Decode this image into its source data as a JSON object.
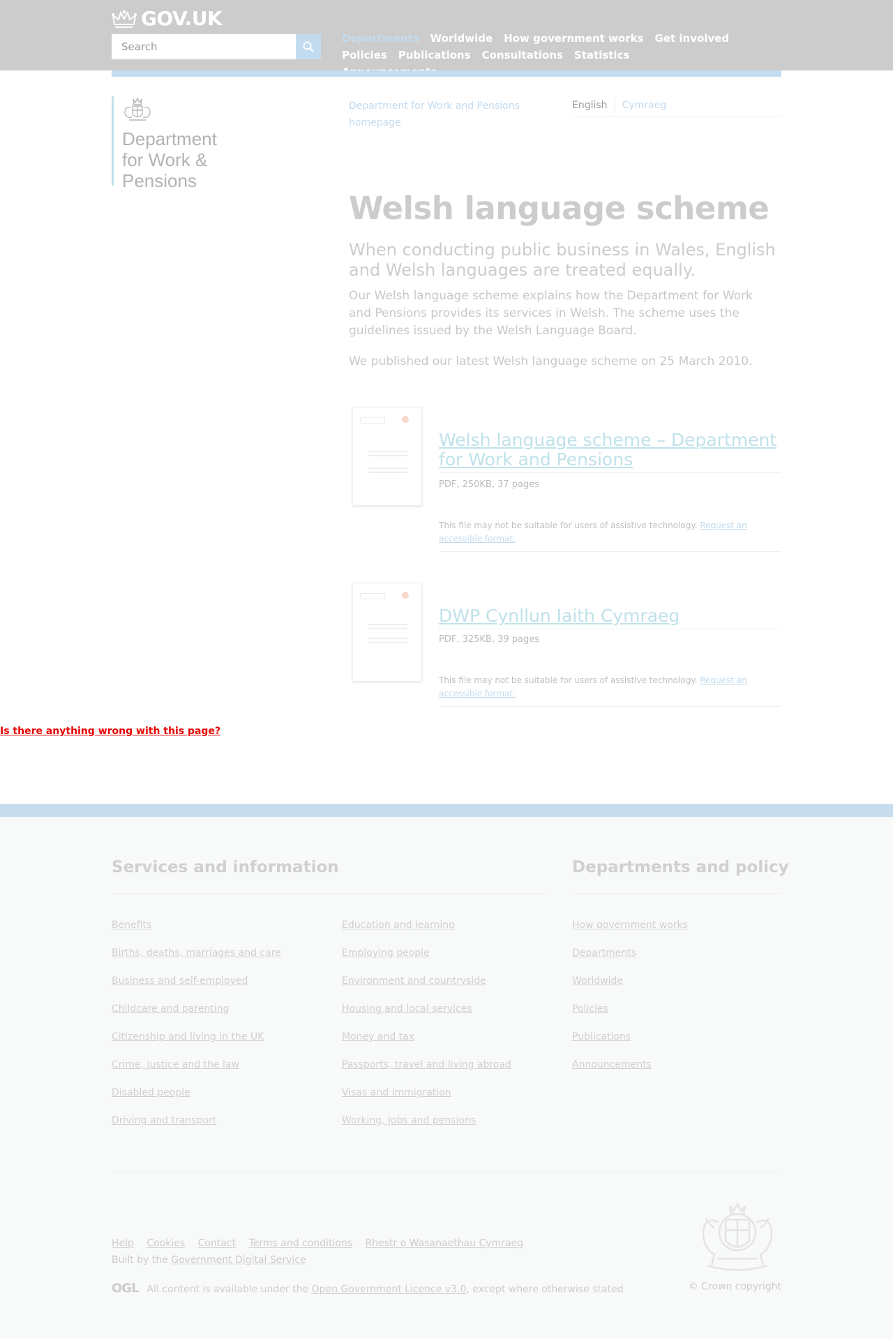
{
  "header": {
    "logo_text": "GOV.UK",
    "search": {
      "placeholder": "Search"
    },
    "nav": [
      {
        "label": "Departments",
        "active": true
      },
      {
        "label": "Worldwide"
      },
      {
        "label": "How government works"
      },
      {
        "label": "Get involved"
      },
      {
        "label": "Policies"
      },
      {
        "label": "Publications"
      },
      {
        "label": "Consultations"
      },
      {
        "label": "Statistics"
      },
      {
        "label": "Announcements"
      }
    ]
  },
  "organisation": {
    "name_lines": [
      "Department",
      "for Work &",
      "Pensions"
    ],
    "homepage_link": "Department for Work and Pensions homepage"
  },
  "language": {
    "current": "English",
    "other": "Cymraeg"
  },
  "content": {
    "title": "Welsh language scheme",
    "summary": "When conducting public business in Wales, English and Welsh languages are treated equally.",
    "body": [
      "Our Welsh language scheme explains how the Department for Work and Pensions provides its services in Welsh. The scheme uses the guidelines issued by the Welsh Language Board.",
      "We published our latest Welsh language scheme on 25 March 2010."
    ]
  },
  "attachments": [
    {
      "title": "Welsh language scheme – Department for Work and Pensions",
      "meta": "PDF, 250KB, 37 pages",
      "note": "This file may not be suitable for users of assistive technology.",
      "request_link": "Request an accessible format."
    },
    {
      "title": "DWP Cynllun Iaith Cymraeg",
      "meta": "PDF, 325KB, 39 pages",
      "note": "This file may not be suitable for users of assistive technology.",
      "request_link": "Request an accessible format."
    }
  ],
  "report_link": "Is there anything wrong with this page?",
  "footer": {
    "services_heading": "Services and information",
    "departments_heading": "Departments and policy",
    "services_col1": [
      "Benefits",
      "Births, deaths, marriages and care",
      "Business and self-employed",
      "Childcare and parenting",
      "Citizenship and living in the UK",
      "Crime, justice and the law",
      "Disabled people",
      "Driving and transport"
    ],
    "services_col2": [
      "Education and learning",
      "Employing people",
      "Environment and countryside",
      "Housing and local services",
      "Money and tax",
      "Passports, travel and living abroad",
      "Visas and immigration",
      "Working, jobs and pensions"
    ],
    "departments_links": [
      "How government works",
      "Departments",
      "Worldwide",
      "Policies",
      "Publications",
      "Announcements"
    ],
    "meta_links": [
      "Help",
      "Cookies",
      "Contact",
      "Terms and conditions",
      "Rhestr o Wasanaethau Cymraeg"
    ],
    "built_by_prefix": "Built by the",
    "built_by_link": "Government Digital Service",
    "ogl_logo": "OGL",
    "licence_prefix": "All content is available under the",
    "licence_link": "Open Government Licence v3.0",
    "licence_suffix": ", except where otherwise stated",
    "copyright": "© Crown copyright"
  }
}
